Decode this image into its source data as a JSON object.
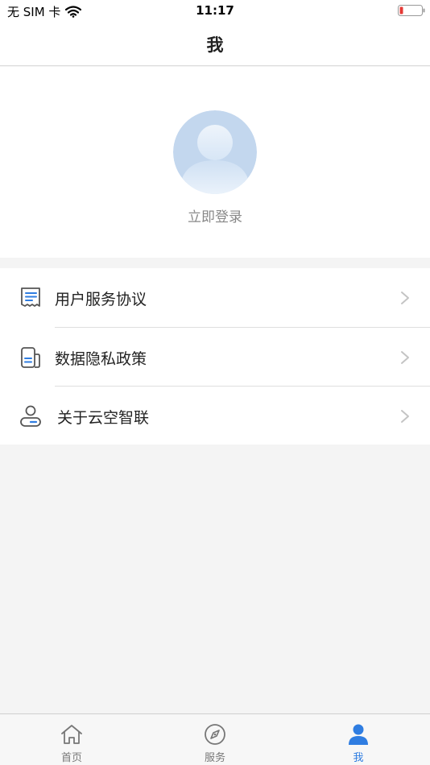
{
  "status_bar": {
    "carrier": "无 SIM 卡",
    "time": "11:17"
  },
  "header": {
    "title": "我"
  },
  "profile": {
    "login_text": "立即登录"
  },
  "menu": {
    "items": [
      {
        "label": "用户服务协议",
        "icon": "document-list-icon"
      },
      {
        "label": "数据隐私政策",
        "icon": "privacy-document-icon"
      },
      {
        "label": "关于云空智联",
        "icon": "about-user-icon"
      }
    ]
  },
  "tab_bar": {
    "tabs": [
      {
        "label": "首页",
        "icon": "home-icon",
        "active": false
      },
      {
        "label": "服务",
        "icon": "compass-icon",
        "active": false
      },
      {
        "label": "我",
        "icon": "user-icon",
        "active": true
      }
    ]
  },
  "colors": {
    "accent": "#2f7de1",
    "battery_low": "#e53935",
    "background": "#f4f4f4"
  }
}
